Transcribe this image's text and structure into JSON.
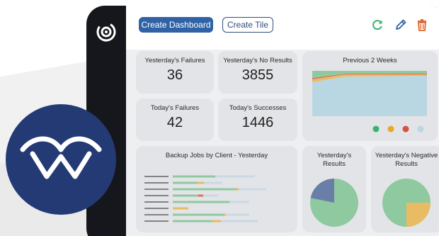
{
  "toolbar": {
    "create_dashboard": "Create Dashboard",
    "create_tile": "Create Tile",
    "refresh_icon": "refresh-icon",
    "edit_icon": "pencil-icon",
    "delete_icon": "trash-icon"
  },
  "tiles": {
    "yesterday_failures": {
      "label": "Yesterday's Failures",
      "value": "36"
    },
    "yesterday_no_results": {
      "label": "Yesterday's No Results",
      "value": "3855"
    },
    "today_failures": {
      "label": "Today's Failures",
      "value": "42"
    },
    "today_successes": {
      "label": "Today's Successes",
      "value": "1446"
    },
    "previous_weeks": {
      "title": "Previous 2 Weeks"
    },
    "backup_jobs": {
      "title": "Backup Jobs by Client - Yesterday"
    },
    "yesterday_results": {
      "title": "Yesterday's Results"
    },
    "yesterday_negative": {
      "title": "Yesterday's Negative Results"
    }
  },
  "colors": {
    "success": "#8fc9a0",
    "warning": "#e9bb62",
    "failure": "#d9725e",
    "no_result": "#b9d6e3",
    "pie_blue": "#6a7fa8",
    "brand_navy": "#243a75",
    "accent_green": "#39b36b",
    "accent_orange": "#e0652a"
  },
  "legend_dots": [
    "#39b36b",
    "#e7a927",
    "#d6533f",
    "#b9d6e3"
  ]
}
